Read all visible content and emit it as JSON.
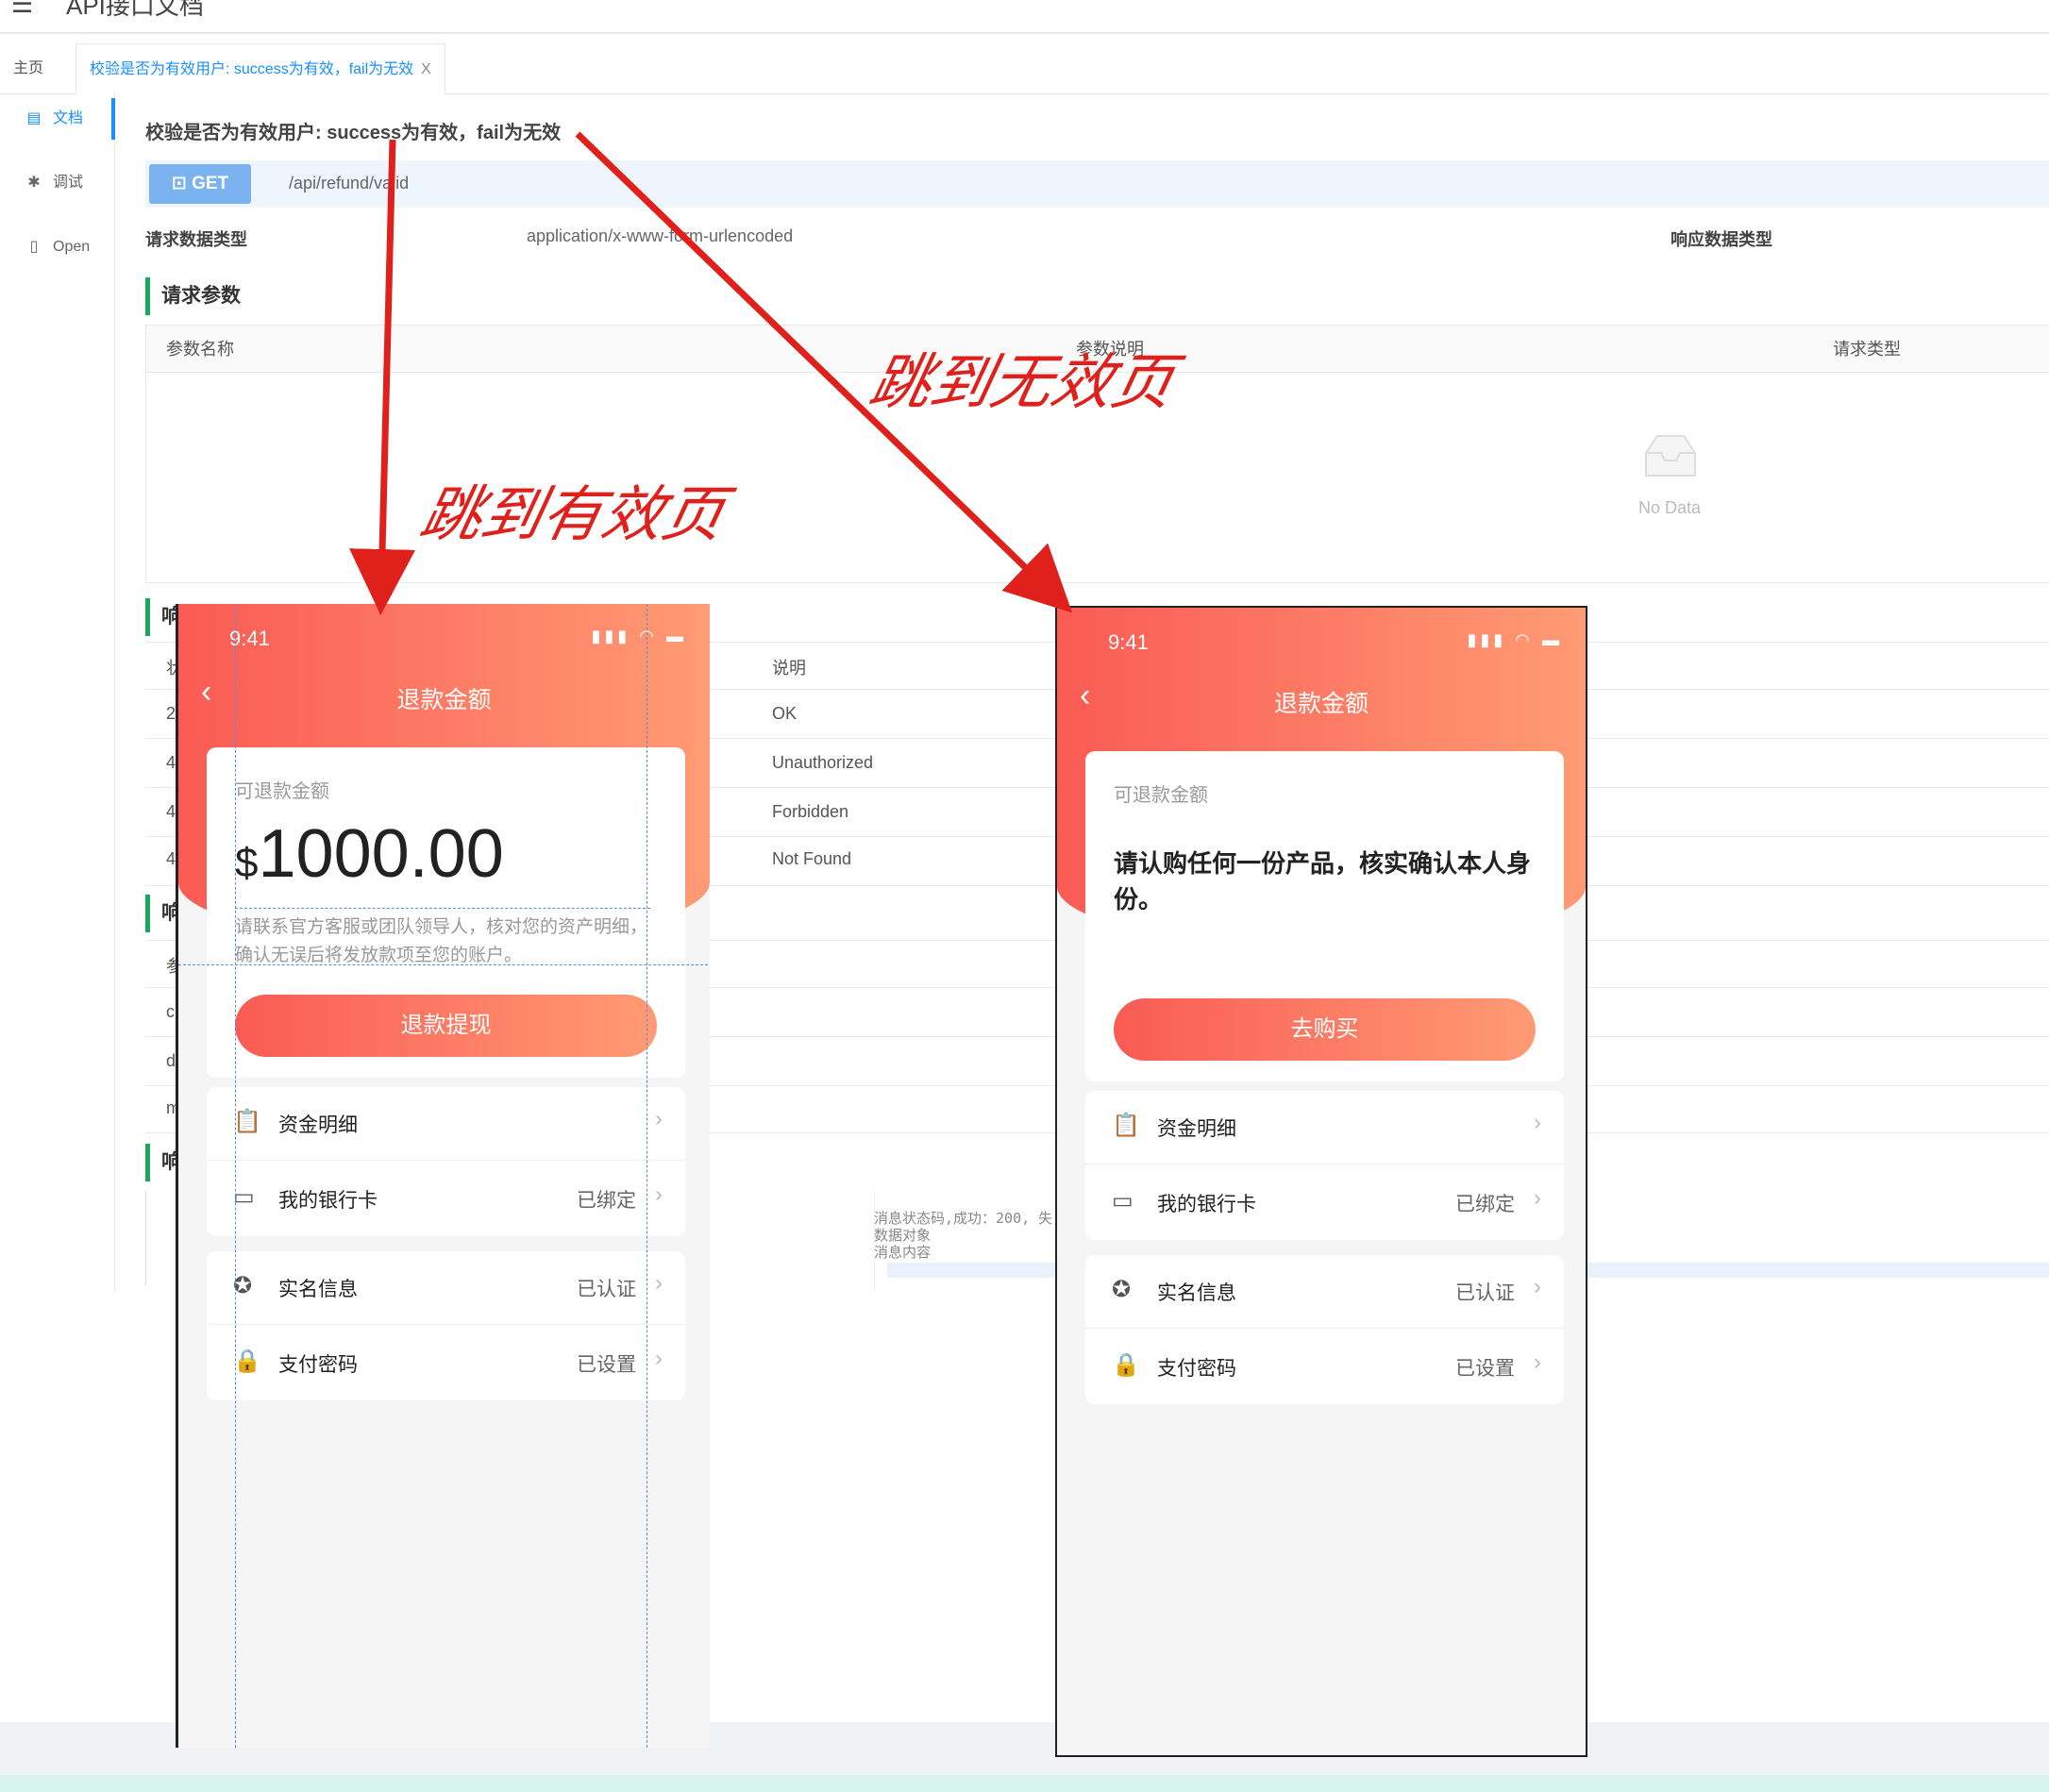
{
  "header": {
    "app_title": "API接口文档"
  },
  "tabs": {
    "home": "主页",
    "active": "校验是否为有效用户: success为有效，fail为无效",
    "close": "X"
  },
  "side": {
    "doc": "文档",
    "debug": "调试",
    "open": "Open"
  },
  "doc": {
    "title": "校验是否为有效用户: success为有效，fail为无效",
    "method": "GET",
    "url": "/api/refund/valid",
    "req_type_label": "请求数据类型",
    "req_type_value": "application/x-www-form-urlencoded",
    "resp_type_label": "响应数据类型",
    "params_heading": "请求参数",
    "params_cols": [
      "参数名称",
      "参数说明",
      "请求类型"
    ],
    "no_data": "No Data",
    "hidden_heading": "响",
    "status_col_desc": "说明",
    "status_rows": [
      "OK",
      "Unauthorized",
      "Forbidden",
      "Not Found"
    ],
    "row_prefixes": [
      "状",
      "2",
      "4",
      "4",
      "4"
    ],
    "row_prefixes2": [
      "参",
      "c",
      "d",
      "m"
    ],
    "code_lines": [
      "消息状态码,成功：200, 失",
      "数据对象",
      "消息内容"
    ]
  },
  "annotations": {
    "valid": "跳到有效页",
    "invalid": "跳到无效页"
  },
  "phone_valid": {
    "time": "9:41",
    "status": "▮▮▮ ◠ ▬",
    "back": "‹",
    "title": "退款金额",
    "card_label": "可退款金额",
    "currency": "$",
    "amount": "1000.00",
    "note": "请联系官方客服或团队领导人，核对您的资产明细，确认无误后将发放款项至您的账户。",
    "button": "退款提现",
    "rows": [
      {
        "icon": "clipboard-icon",
        "glyph": "📋",
        "label": "资金明细",
        "value": ""
      },
      {
        "icon": "bankcard-icon",
        "glyph": "▭",
        "label": "我的银行卡",
        "value": "已绑定"
      },
      {
        "icon": "badge-icon",
        "glyph": "✪",
        "label": "实名信息",
        "value": "已认证"
      },
      {
        "icon": "lock-icon",
        "glyph": "🔒",
        "label": "支付密码",
        "value": "已设置"
      }
    ],
    "chevron": "›"
  },
  "phone_invalid": {
    "time": "9:41",
    "status": "▮▮▮ ◠ ▬",
    "back": "‹",
    "title": "退款金额",
    "card_label": "可退款金额",
    "message": "请认购任何一份产品，核实确认本人身份。",
    "button": "去购买",
    "rows": [
      {
        "icon": "clipboard-icon",
        "glyph": "📋",
        "label": "资金明细",
        "value": ""
      },
      {
        "icon": "bankcard-icon",
        "glyph": "▭",
        "label": "我的银行卡",
        "value": "已绑定"
      },
      {
        "icon": "badge-icon",
        "glyph": "✪",
        "label": "实名信息",
        "value": "已认证"
      },
      {
        "icon": "lock-icon",
        "glyph": "🔒",
        "label": "支付密码",
        "value": "已设置"
      }
    ],
    "chevron": "›"
  },
  "colors": {
    "accent": "#1890ff",
    "red_start": "#fa5b54",
    "red_end": "#ff9b74",
    "arrow": "#e0201b",
    "section_bar": "#19a95a"
  }
}
